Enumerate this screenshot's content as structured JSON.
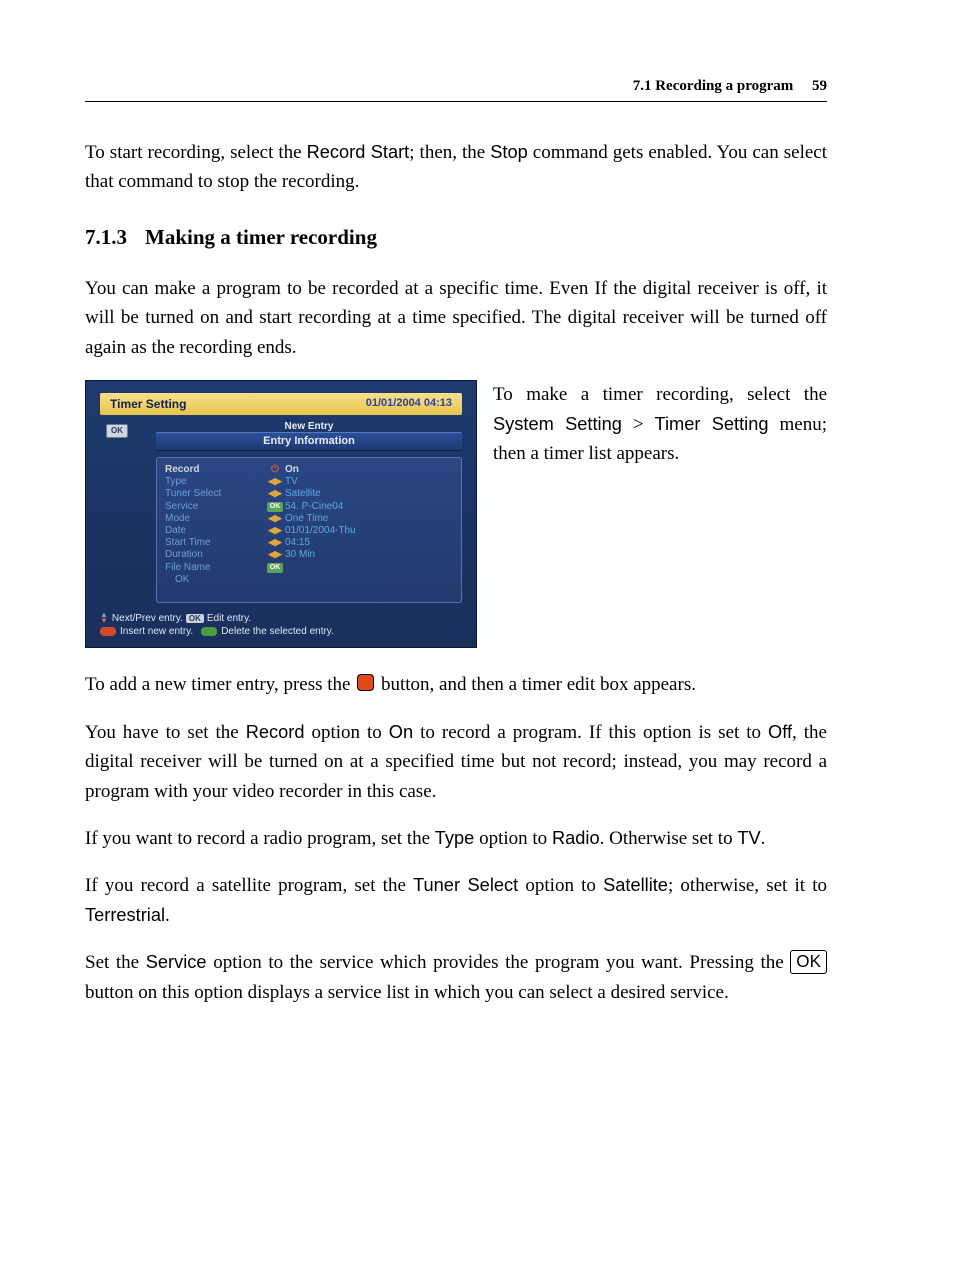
{
  "header": {
    "running_title": "7.1 Recording a program",
    "page_number": "59"
  },
  "section": {
    "number": "7.1.3",
    "title": "Making a timer recording"
  },
  "paragraphs": {
    "p0a": "To start recording, select the ",
    "p0_recordstart": "Record Start",
    "p0b": "; then, the ",
    "p0_stop": "Stop",
    "p0c": " command gets enabled. You can select that command to stop the recording.",
    "p1": "You can make a program to be recorded at a specific time. Even If the digital receiver is off, it will be turned on and start recording at a time specified. The digital receiver will be turned off again as the recording ends.",
    "wrap_a": "To make a timer recording, select the ",
    "wrap_syssetting": "System Setting",
    "wrap_gt": " > ",
    "wrap_timersetting": "Timer Setting",
    "wrap_b": " menu; then a timer list appears.",
    "p3a": "To add a new timer entry, press the ",
    "p3b": " button, and then a timer edit box appears.",
    "p4a": "You have to set the ",
    "p4_record": "Record",
    "p4b": " option to ",
    "p4_on": "On",
    "p4c": " to record a program. If this option is set to ",
    "p4_off": "Off",
    "p4d": ", the digital receiver will be turned on at a specified time but not record; instead, you may record a program with your video recorder in this case.",
    "p5a": "If you want to record a radio program, set the ",
    "p5_type": "Type",
    "p5b": " option to ",
    "p5_radio": "Radio",
    "p5c": ". Otherwise set to ",
    "p5_tv": "TV",
    "p5d": ".",
    "p6a": "If you record a satellite program, set the ",
    "p6_tuner": "Tuner Select",
    "p6b": " option to ",
    "p6_sat": "Satellite",
    "p6c": "; otherwise, set it to ",
    "p6_ter": "Terrestrial",
    "p6d": ".",
    "p7a": "Set the ",
    "p7_service": "Service",
    "p7b": " option to the service which provides the program you want.  Pressing the ",
    "p7_ok": "OK",
    "p7c": " button on this option displays a service list in which you can select a desired service."
  },
  "shot": {
    "title": "Timer Setting",
    "clock": "01/01/2004 04:13",
    "ok_badge": "OK",
    "new_entry": "New Entry",
    "subhead": "Entry Information",
    "rows": {
      "record": {
        "label": "Record",
        "icon": "power",
        "val": "On"
      },
      "type": {
        "label": "Type",
        "icon": "arrows",
        "val": "TV"
      },
      "tuner": {
        "label": "Tuner Select",
        "icon": "arrows",
        "val": "Satellite"
      },
      "service": {
        "label": "Service",
        "icon": "ok",
        "val": "54. P-Cine04"
      },
      "mode": {
        "label": "Mode",
        "icon": "arrows",
        "val": "One Time"
      },
      "date": {
        "label": "Date",
        "icon": "arrows",
        "val": "01/01/2004-Thu"
      },
      "start": {
        "label": "Start Time",
        "icon": "arrows",
        "val": "04:15"
      },
      "duration": {
        "label": "Duration",
        "icon": "arrows",
        "val": "30 Min"
      },
      "filename": {
        "label": "File Name",
        "icon": "ok",
        "val": ""
      },
      "okrow": {
        "label": "OK",
        "icon": "",
        "val": ""
      }
    },
    "footer": {
      "line1a": "Next/Prev entry.",
      "line1_ok": "OK",
      "line1b": "Edit entry.",
      "line2a": "Insert new entry.",
      "line2b": "Delete the selected entry."
    }
  }
}
